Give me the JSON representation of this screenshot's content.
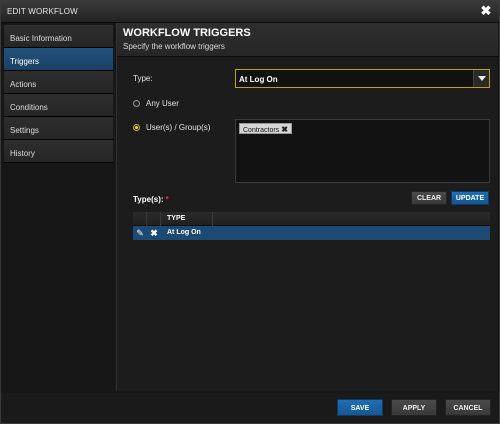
{
  "window": {
    "title": "EDIT WORKFLOW",
    "close_icon": "close-icon"
  },
  "sidebar": {
    "items": [
      {
        "label": "Basic Information",
        "active": false
      },
      {
        "label": "Triggers",
        "active": true
      },
      {
        "label": "Actions",
        "active": false
      },
      {
        "label": "Conditions",
        "active": false
      },
      {
        "label": "Settings",
        "active": false
      },
      {
        "label": "History",
        "active": false
      }
    ]
  },
  "panel": {
    "title": "WORKFLOW TRIGGERS",
    "subtitle": "Specify the workflow triggers"
  },
  "form": {
    "type_label": "Type:",
    "type_value": "At Log On",
    "any_user_label": "Any User",
    "users_groups_label": "User(s) / Group(s)",
    "users_groups_selected": true,
    "chips": [
      "Contractors"
    ]
  },
  "types": {
    "label": "Type(s):",
    "required_mark": "*",
    "clear_label": "CLEAR",
    "update_label": "UPDATE",
    "column_header": "TYPE",
    "rows": [
      "At Log On"
    ]
  },
  "footer": {
    "save_label": "SAVE",
    "apply_label": "APPLY",
    "cancel_label": "CANCEL"
  },
  "colors": {
    "accent_blue": "#1f6fb5",
    "active_nav": "#1b4166",
    "select_border": "#b9a21c",
    "required": "#ee3333"
  }
}
